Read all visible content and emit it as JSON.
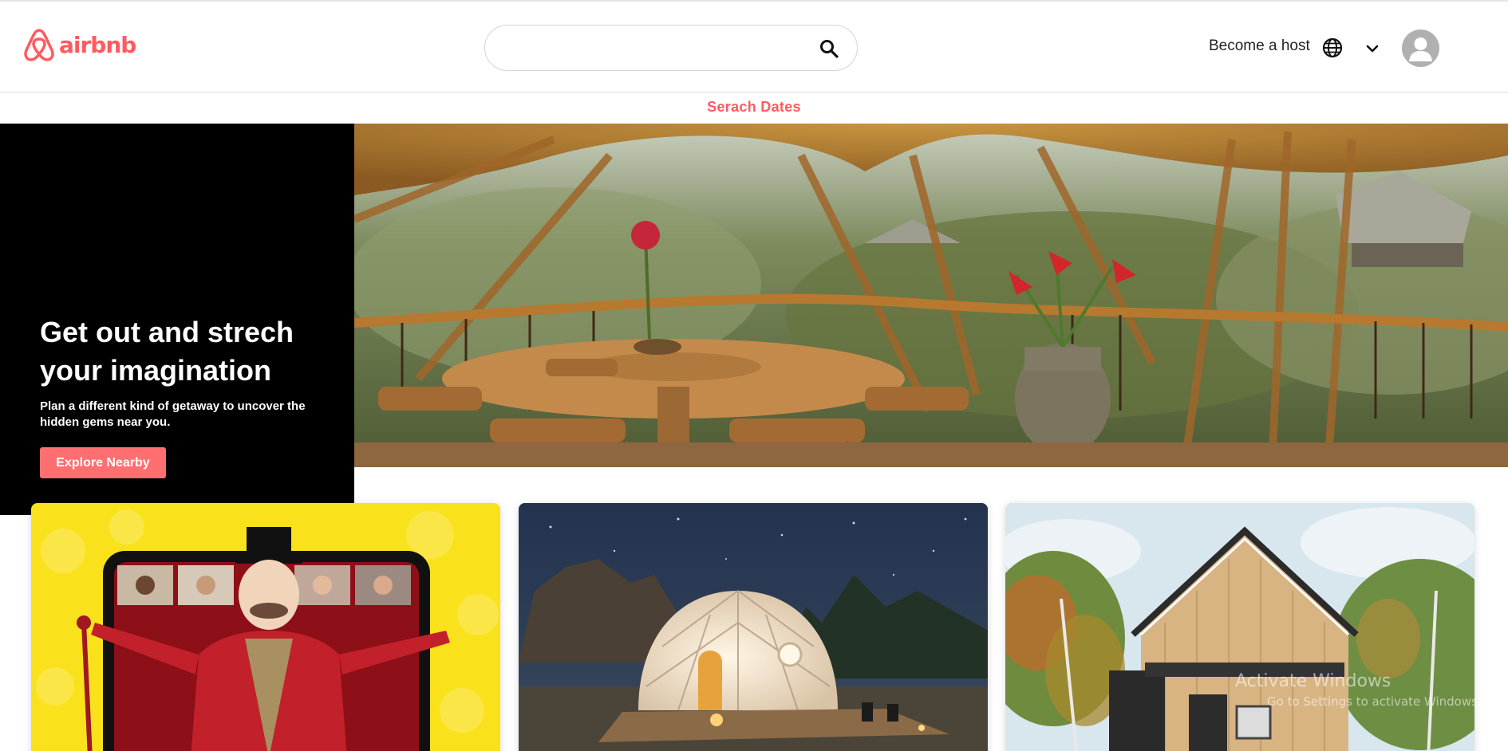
{
  "header": {
    "logo_text": "airbnb",
    "search_placeholder": "",
    "become_host": "Become a host"
  },
  "subnav": {
    "search_dates": "Serach Dates"
  },
  "hero": {
    "title": "Get out and strech your imagination",
    "subtitle": "Plan a different kind of getaway to uncover the hidden gems near you.",
    "button": "Explore Nearby"
  },
  "watermark": {
    "line1": "Activate Windows",
    "line2": "Go to Settings to activate Windows."
  },
  "colors": {
    "brand": "#ff5a5f",
    "button": "#ff6f71",
    "panel": "#000000"
  },
  "icons": {
    "logo": "airbnb-belo-icon",
    "search": "search-icon",
    "globe": "globe-icon",
    "dropdown": "chevron-down-icon",
    "avatar": "user-avatar-icon"
  }
}
